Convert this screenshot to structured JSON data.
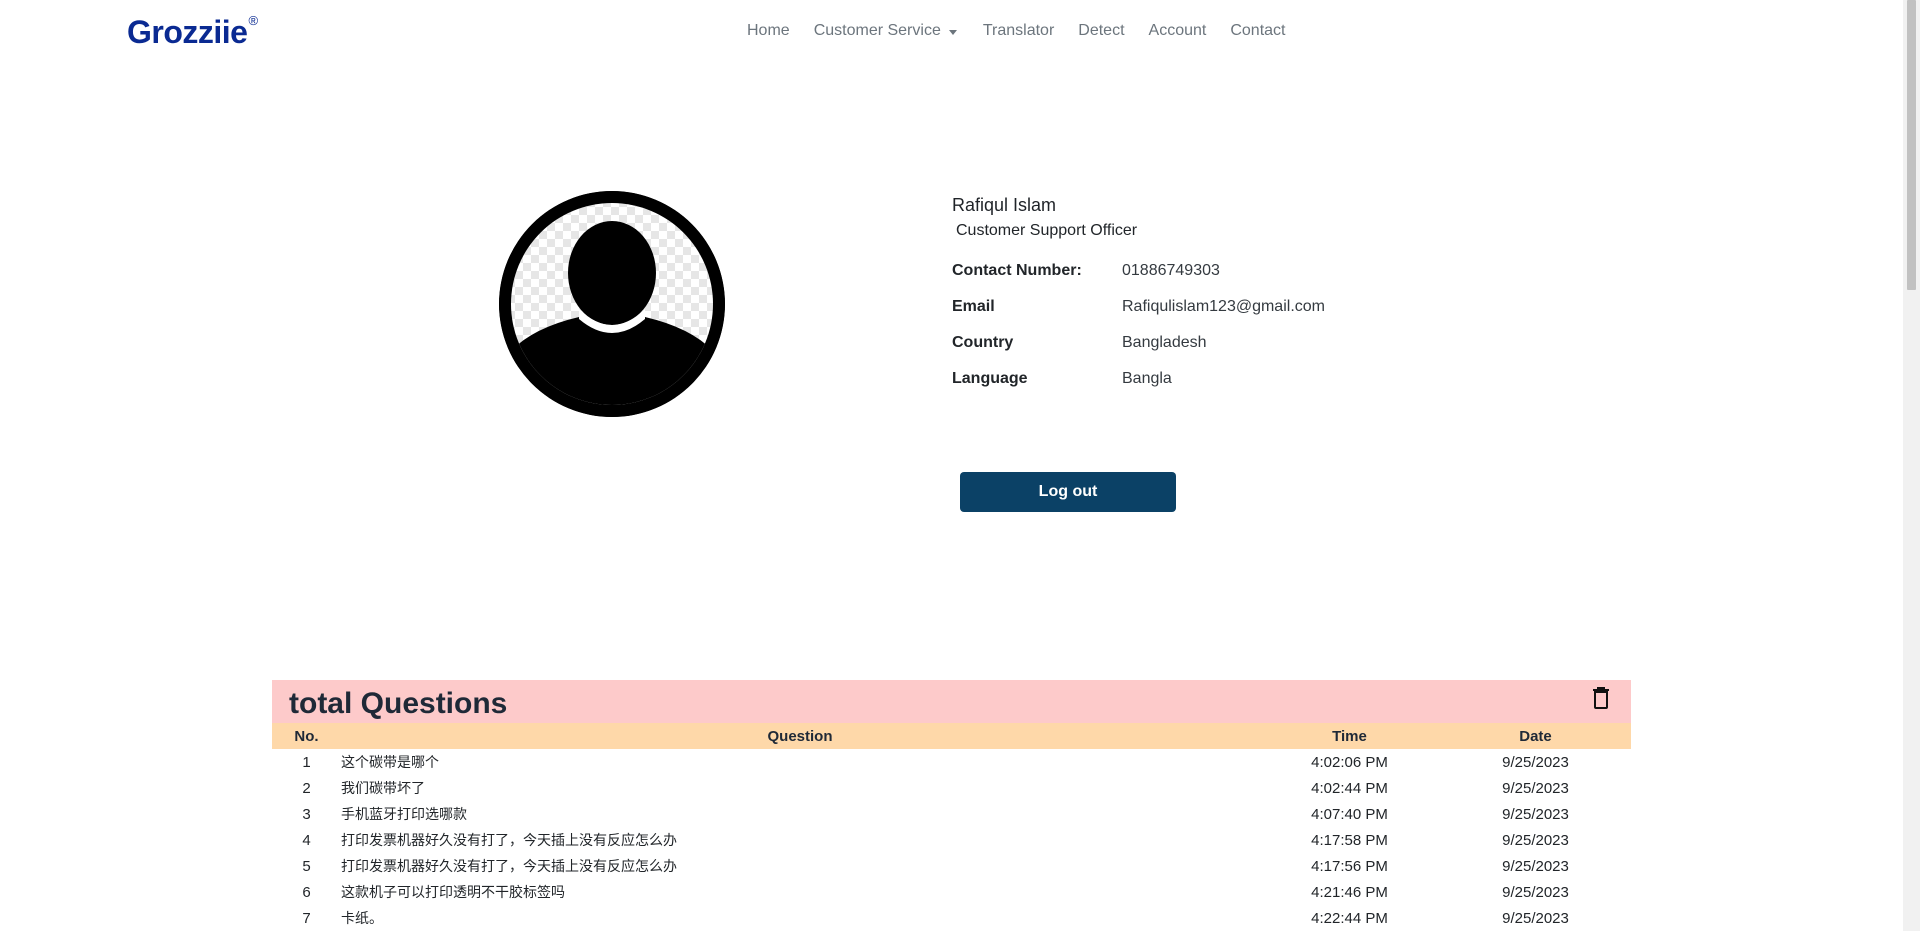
{
  "brand": {
    "name": "Grozziie",
    "mark": "®"
  },
  "nav": {
    "home": "Home",
    "customer_service": "Customer Service",
    "translator": "Translator",
    "detect": "Detect",
    "account": "Account",
    "contact": "Contact"
  },
  "profile": {
    "name": "Rafiqul Islam",
    "role": "Customer Support Officer",
    "fields": [
      {
        "label": "Contact Number:",
        "value": "01886749303"
      },
      {
        "label": "Email",
        "value": "Rafiqulislam123@gmail.com"
      },
      {
        "label": "Country",
        "value": "Bangladesh"
      },
      {
        "label": "Language",
        "value": "Bangla"
      }
    ],
    "logout_label": "Log out"
  },
  "questions": {
    "title": "total Questions",
    "columns": {
      "no": "No.",
      "question": "Question",
      "time": "Time",
      "date": "Date"
    },
    "rows": [
      {
        "no": "1",
        "question": "这个碳带是哪个",
        "time": "4:02:06 PM",
        "date": "9/25/2023"
      },
      {
        "no": "2",
        "question": "我们碳带坏了",
        "time": "4:02:44 PM",
        "date": "9/25/2023"
      },
      {
        "no": "3",
        "question": "手机蓝牙打印选哪款",
        "time": "4:07:40 PM",
        "date": "9/25/2023"
      },
      {
        "no": "4",
        "question": "打印发票机器好久没有打了，今天插上没有反应怎么办",
        "time": "4:17:58 PM",
        "date": "9/25/2023"
      },
      {
        "no": "5",
        "question": "打印发票机器好久没有打了，今天插上没有反应怎么办",
        "time": "4:17:56 PM",
        "date": "9/25/2023"
      },
      {
        "no": "6",
        "question": "这款机子可以打印透明不干胶标签吗",
        "time": "4:21:46 PM",
        "date": "9/25/2023"
      },
      {
        "no": "7",
        "question": "卡纸。",
        "time": "4:22:44 PM",
        "date": "9/25/2023"
      }
    ]
  },
  "colors": {
    "brand": "#0a2a92",
    "logout_bg": "#0b4166",
    "panel_header": "#fdcaca",
    "table_header": "#fed8a9"
  },
  "icons": {
    "avatar": "user-silhouette-icon",
    "trash": "trash-icon",
    "caret": "caret-down-icon"
  }
}
